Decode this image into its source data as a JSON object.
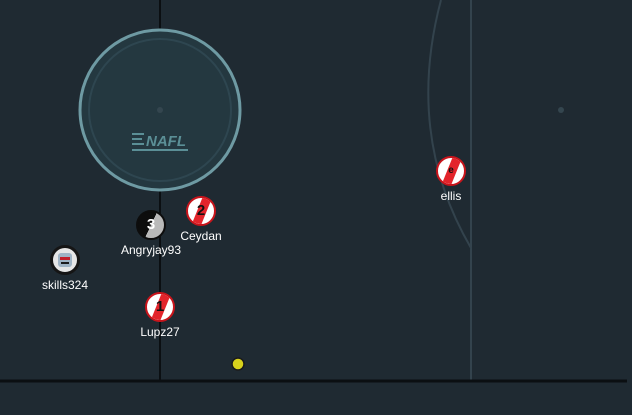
{
  "pitch": {
    "background": "#1f2a32",
    "line_color": "#33434d",
    "boundary_color": "#0b0f12",
    "circle_color": "#6e9aa3",
    "logo_text": "NAFL",
    "ball_color": "#d8d21c"
  },
  "players": [
    {
      "name": "Ceydan",
      "number": "2",
      "style": "red"
    },
    {
      "name": "Angryjay93",
      "number": "3",
      "style": "black"
    },
    {
      "name": "skills324",
      "number": "",
      "style": "avatar"
    },
    {
      "name": "Lupz27",
      "number": "1",
      "style": "red"
    },
    {
      "name": "ellis",
      "number": "e",
      "style": "red"
    }
  ]
}
